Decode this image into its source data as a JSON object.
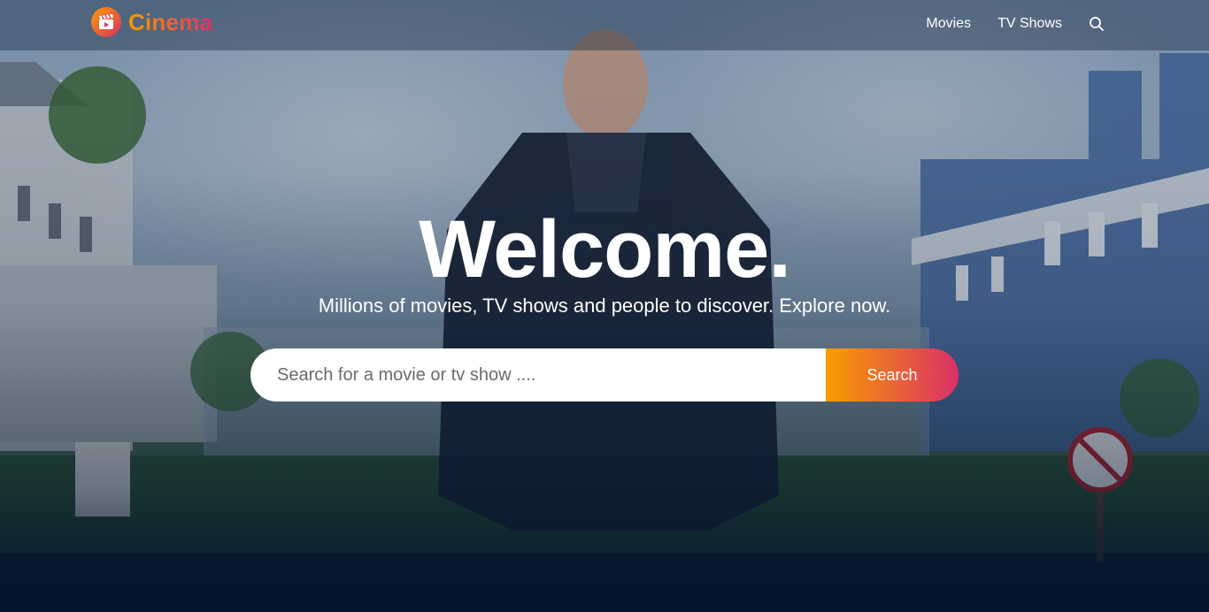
{
  "brand": {
    "name": "Cinema",
    "logo_icon": "clapperboard-icon",
    "gradient_start": "#f89e00",
    "gradient_end": "#da2f68"
  },
  "nav": {
    "items": [
      {
        "label": "Movies"
      },
      {
        "label": "TV Shows"
      }
    ],
    "search_icon": "search-icon"
  },
  "hero": {
    "title": "Welcome.",
    "subtitle": "Millions of movies, TV shows and people to discover. Explore now.",
    "search": {
      "placeholder": "Search for a movie or tv show ....",
      "value": "",
      "button_label": "Search"
    }
  },
  "theme": {
    "background": "#04152d",
    "text": "#ffffff"
  }
}
